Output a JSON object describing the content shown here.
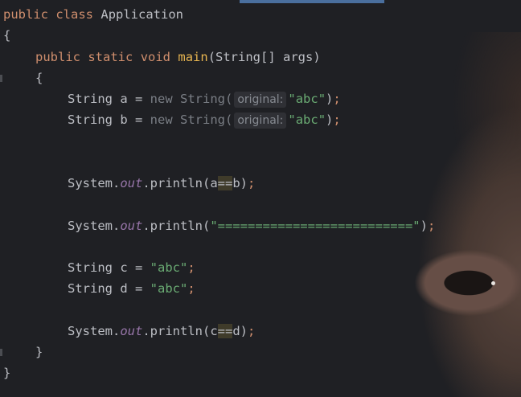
{
  "code": {
    "line1": {
      "kw1": "public",
      "kw2": "class",
      "name": "Application"
    },
    "line2": {
      "brace": "{"
    },
    "line3": {
      "kw1": "public",
      "kw2": "static",
      "kw3": "void",
      "method": "main",
      "params": "(String[] args)"
    },
    "line4": {
      "brace": "{"
    },
    "line5": {
      "type": "String",
      "var": " a = ",
      "new": "new",
      "ctor": " String(",
      "hint_label": "original:",
      "str": "\"abc\"",
      "close": ")",
      "semi": ";"
    },
    "line6": {
      "type": "String",
      "var": " b = ",
      "new": "new",
      "ctor": " String(",
      "hint_label": "original:",
      "str": "\"abc\"",
      "close": ")",
      "semi": ";"
    },
    "line7": {
      "cls": "System.",
      "field": "out",
      "call": ".println(a",
      "op": "==",
      "rest": "b)",
      "semi": ";"
    },
    "line8": {
      "cls": "System.",
      "field": "out",
      "call": ".println(",
      "str": "\"==========================\"",
      "close": ")",
      "semi": ";"
    },
    "line9": {
      "type": "String",
      "var": " c = ",
      "str": "\"abc\"",
      "semi": ";"
    },
    "line10": {
      "type": "String",
      "var": " d = ",
      "str": "\"abc\"",
      "semi": ";"
    },
    "line11": {
      "cls": "System.",
      "field": "out",
      "call": ".println(c",
      "op": "==",
      "rest": "d)",
      "semi": ";"
    },
    "line12": {
      "brace": "}"
    },
    "line13": {
      "brace": "}"
    }
  },
  "colors": {
    "background": "#1f2024",
    "keyword": "#cf8e6d",
    "string": "#6aab73",
    "method": "#e6b450",
    "field": "#9876aa",
    "scroll_indicator": "#4a6f9e"
  }
}
